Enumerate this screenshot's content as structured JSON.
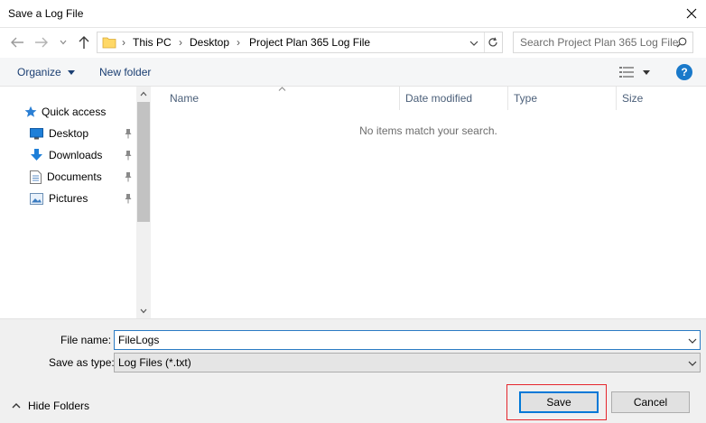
{
  "window": {
    "title": "Save a Log File"
  },
  "navigation": {
    "breadcrumbs": [
      "This PC",
      "Desktop",
      "Project Plan 365 Log File"
    ],
    "search_placeholder": "Search Project Plan 365 Log File"
  },
  "toolbar": {
    "organize_label": "Organize",
    "new_folder_label": "New folder",
    "help_label": "?"
  },
  "sidebar": {
    "quick_access_label": "Quick access",
    "items": [
      {
        "label": "Desktop",
        "icon": "desktop-icon",
        "pinned": true
      },
      {
        "label": "Downloads",
        "icon": "downloads-icon",
        "pinned": true
      },
      {
        "label": "Documents",
        "icon": "documents-icon",
        "pinned": true
      },
      {
        "label": "Pictures",
        "icon": "pictures-icon",
        "pinned": true
      }
    ]
  },
  "file_list": {
    "columns": [
      "Name",
      "Date modified",
      "Type",
      "Size"
    ],
    "empty_message": "No items match your search."
  },
  "form": {
    "file_name_label": "File name:",
    "file_name_value": "FileLogs",
    "save_as_type_label": "Save as type:",
    "save_as_type_value": "Log Files (*.txt)"
  },
  "footer": {
    "hide_folders_label": "Hide Folders",
    "save_label": "Save",
    "cancel_label": "Cancel"
  },
  "colors": {
    "accent": "#0078d7",
    "link_text": "#1a3e72",
    "highlight_outline": "#e5262d"
  }
}
